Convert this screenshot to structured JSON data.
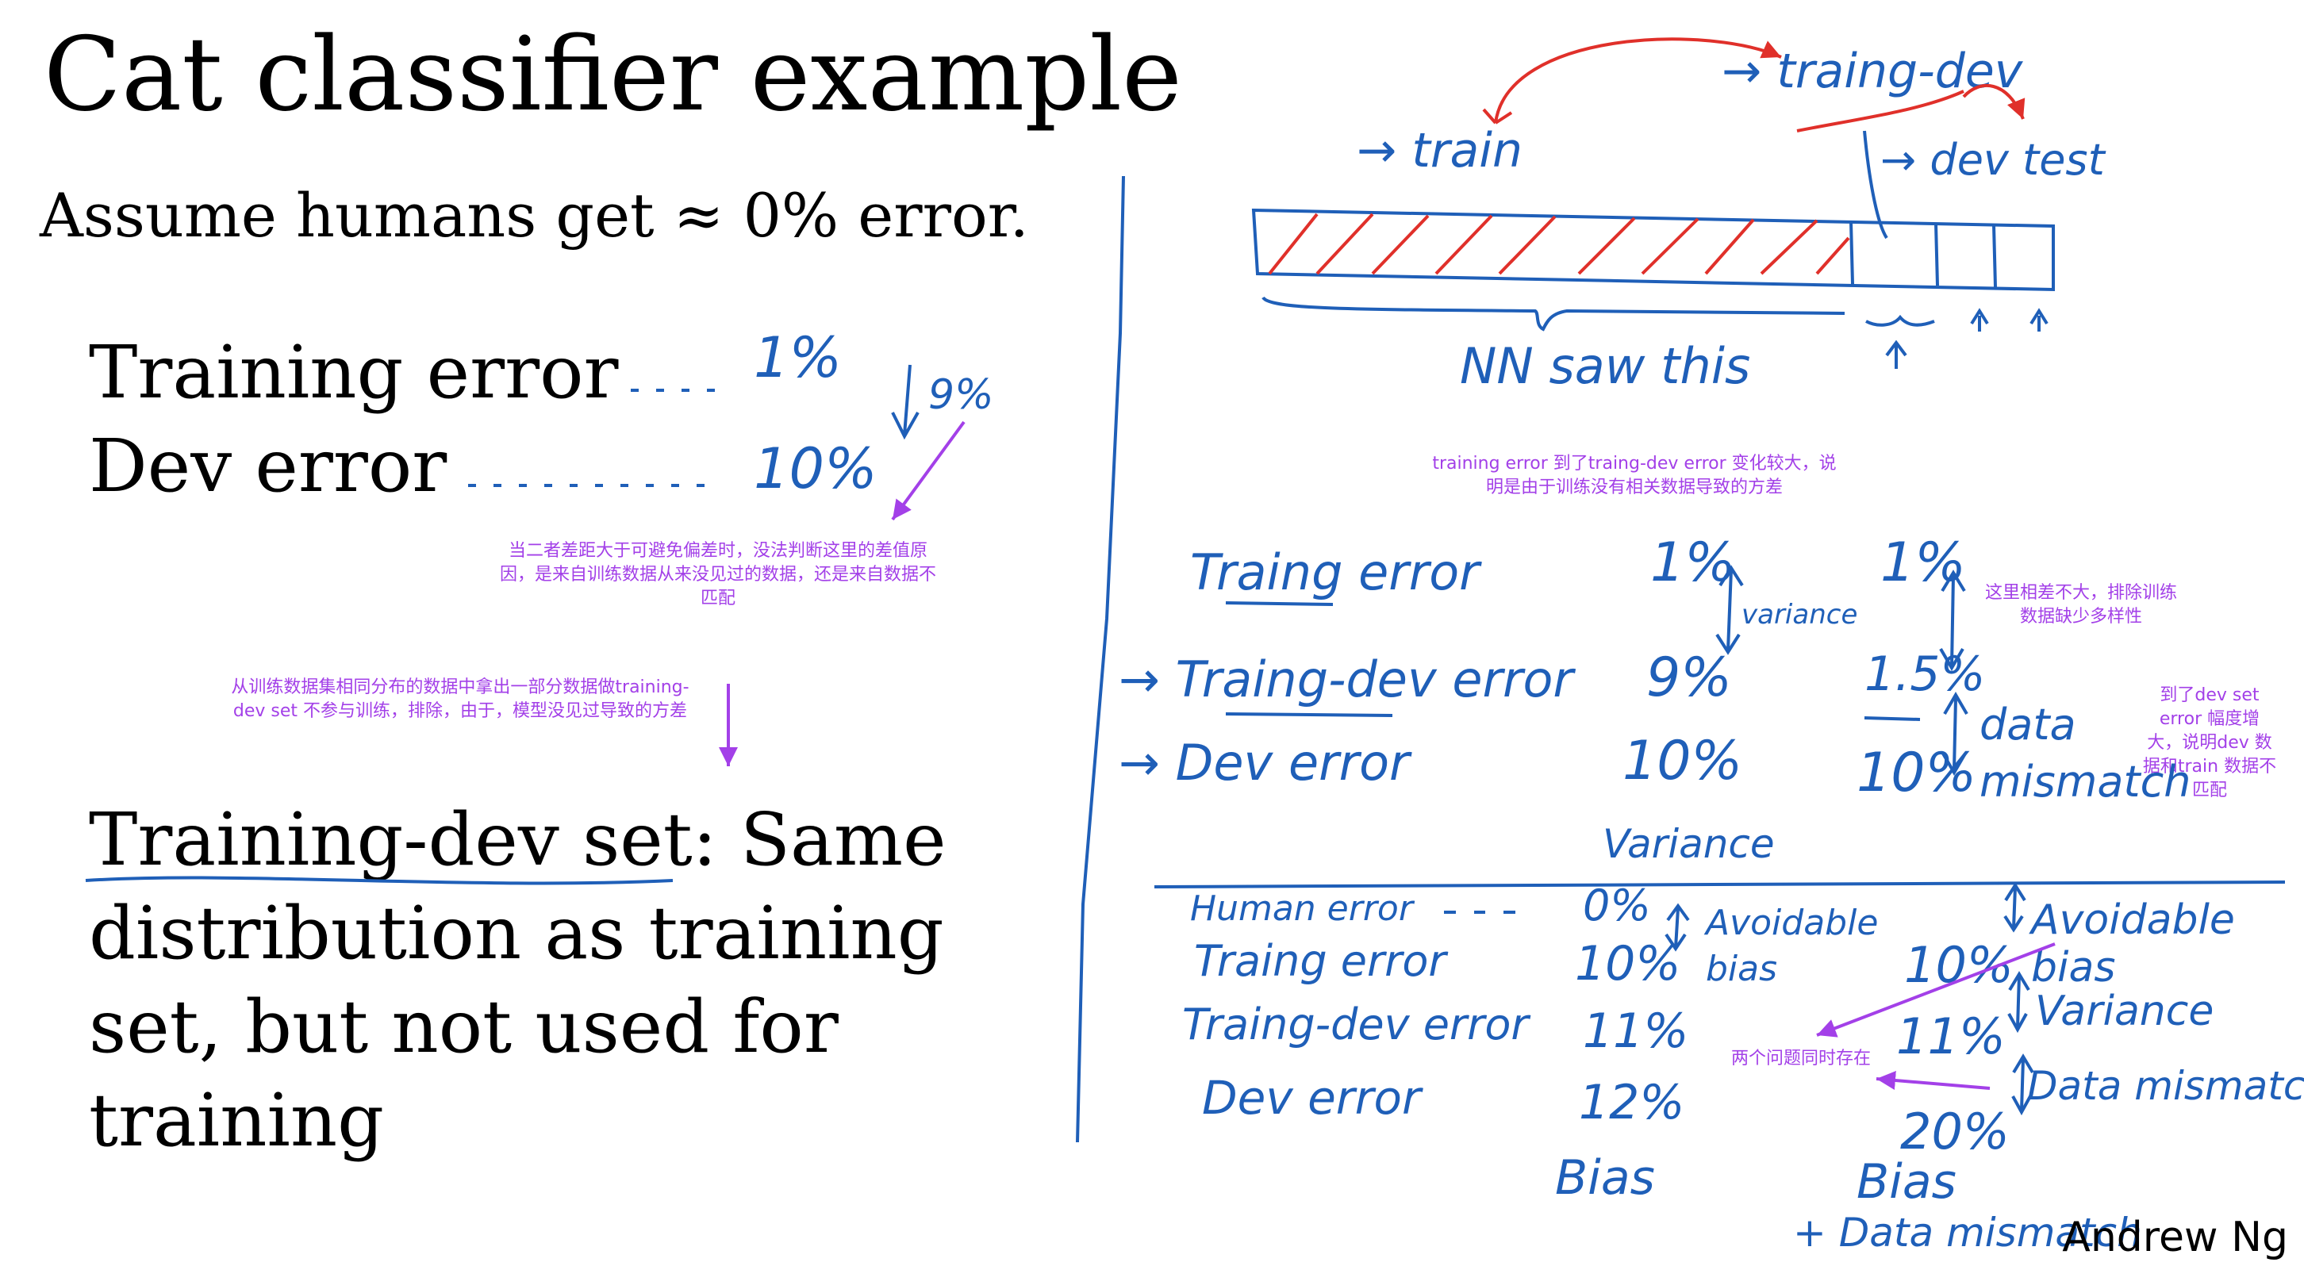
{
  "title": "Cat classifier example",
  "assumption": "Assume humans get ≈ 0% error.",
  "left_labels": {
    "training_error": "Training error",
    "dev_error": "Dev error"
  },
  "left_values": {
    "training_error": "1%",
    "dev_error": "10%",
    "gap": "9%"
  },
  "definition": {
    "term": "Training-dev set:",
    "lines": [
      "Same",
      "distribution as training",
      "set, but not used for",
      "training"
    ]
  },
  "annotations": {
    "gap_note": "当二者差距大于可避免偏差时，没法判断这里的差值原因，是来自训练数据从来没见过的数据，还是来自数据不匹配",
    "split_note": "从训练数据集相同分布的数据中拿出一部分数据做training-dev set 不参与训练，排除，由于，模型没见过导致的方差",
    "variance_note": "training error 到了traing-dev error 变化较大，说明是由于训练没有相关数据导致的方差",
    "small_gap_note": "这里相差不大，排除训练数据缺少多样性",
    "mismatch_note": "到了dev set error 幅度增大，说明dev 数据和train 数据不匹配",
    "both_note": "两个问题同时存在"
  },
  "diagram": {
    "split_labels": {
      "train": "→ train",
      "traing_dev": "→ traing-dev",
      "dev_test": "→ dev test",
      "nn_saw": "NN saw this"
    }
  },
  "table1": {
    "rows": [
      {
        "label": "Traing error",
        "a": "1%",
        "b": "1%"
      },
      {
        "label": "→ Traing-dev error",
        "a": "9%",
        "b": "1.5%"
      },
      {
        "label": "→ Dev error",
        "a": "10%",
        "b": "10%"
      }
    ],
    "variance_mark": "variance",
    "data_mismatch": "data mismatch",
    "footer": "Variance"
  },
  "table2": {
    "rows": [
      {
        "label": "Human error",
        "a": "0%",
        "b": ""
      },
      {
        "label": "Traing error",
        "a": "10%",
        "b": "10%"
      },
      {
        "label": "Traing-dev error",
        "a": "11%",
        "b": "11%"
      },
      {
        "label": "Dev error",
        "a": "12%",
        "b": "20%"
      }
    ],
    "marks": {
      "avoidable_bias": "Avoidable bias",
      "avoidable_right": "Avoidable bias",
      "variance": "Variance",
      "data_mismatch": "Data mismatch"
    },
    "footer_left": "Bias",
    "footer_right_1": "Bias",
    "footer_right_2": "+ Data mismatch"
  },
  "author": "Andrew Ng",
  "colors": {
    "ink_blue": "#1f5fb8",
    "ink_red": "#e0302a",
    "note_purple": "#a340e8"
  }
}
